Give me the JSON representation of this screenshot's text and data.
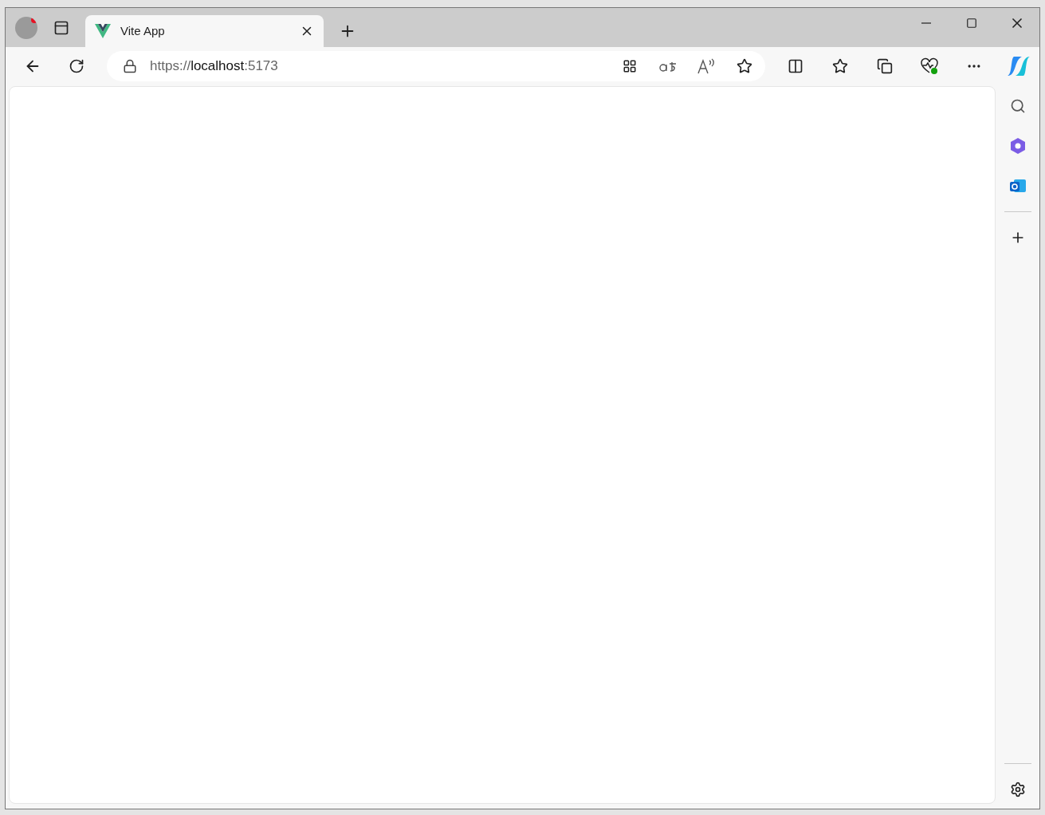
{
  "tabs": [
    {
      "title": "Vite App",
      "selected": true
    }
  ],
  "address_bar": {
    "scheme": "https://",
    "host": "localhost",
    "port": ":5173"
  }
}
